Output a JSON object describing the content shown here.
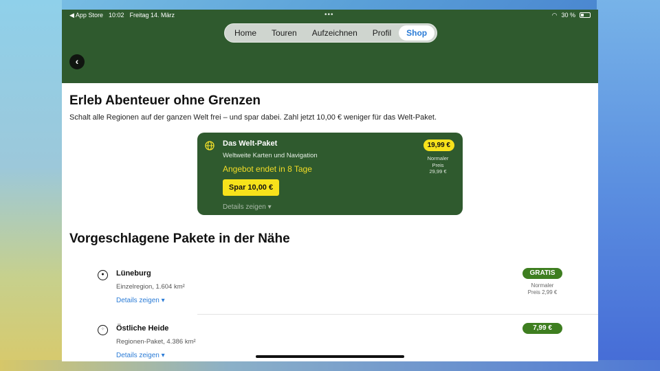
{
  "status_bar": {
    "back_app": "◀ App Store",
    "time": "10:02",
    "date": "Freitag 14. März",
    "dots": "•••",
    "battery": "30 %"
  },
  "nav": {
    "items": [
      {
        "label": "Home",
        "active": false
      },
      {
        "label": "Touren",
        "active": false
      },
      {
        "label": "Aufzeichnen",
        "active": false
      },
      {
        "label": "Profil",
        "active": false
      },
      {
        "label": "Shop",
        "active": true
      }
    ]
  },
  "back_button": {
    "icon": "chevron-left"
  },
  "hero": {
    "title": "Erleb Abenteuer ohne Grenzen",
    "subtitle": "Schalt alle Regionen auf der ganzen Welt frei – und spar dabei. Zahl jetzt 10,00 € weniger für das Welt-Paket."
  },
  "world_package": {
    "name": "Das Welt-Paket",
    "description": "Weltweite Karten und Navigation",
    "offer": "Angebot endet in 8 Tage",
    "save_button": "Spar 10,00 €",
    "details": "Details zeigen ▾",
    "price": "19,99 €",
    "normal_price_label": "Normaler Preis",
    "normal_price": "29,99 €"
  },
  "suggested": {
    "title": "Vorgeschlagene Pakete in der Nähe",
    "items": [
      {
        "name": "Lüneburg",
        "sub": "Einzelregion, 1.604 km²",
        "details": "Details zeigen ▾",
        "price": "GRATIS",
        "normal_price_label": "Normaler",
        "normal_price": "Preis 2,99 €",
        "icon": "region-dot"
      },
      {
        "name": "Östliche Heide",
        "sub": "Regionen-Paket, 4.386 km²",
        "details": "Details zeigen ▾",
        "price": "7,99 €",
        "icon": "region-multi"
      }
    ]
  },
  "colors": {
    "header_green": "#2f5a2e",
    "accent_yellow": "#f7e21b",
    "price_green": "#3e7e20",
    "link_blue": "#2a7bd6"
  }
}
